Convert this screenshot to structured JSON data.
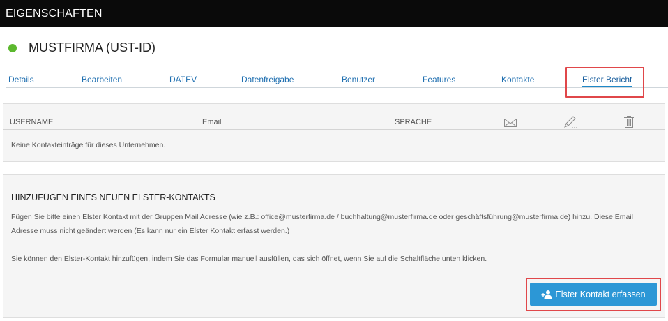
{
  "window": {
    "title": "EIGENSCHAFTEN"
  },
  "company": {
    "name": "MUSTFIRMA (UST-ID)",
    "status_color": "#5cb82e"
  },
  "tabs": [
    {
      "label": "Details"
    },
    {
      "label": "Bearbeiten"
    },
    {
      "label": "DATEV"
    },
    {
      "label": "Datenfreigabe"
    },
    {
      "label": "Benutzer"
    },
    {
      "label": "Features"
    },
    {
      "label": "Kontakte"
    },
    {
      "label": "Elster Bericht",
      "active": true
    }
  ],
  "contacts_table": {
    "columns": [
      "USERNAME",
      "Email",
      "SPRACHE"
    ],
    "action_icons": [
      "envelope-icon",
      "pencil-icon",
      "trash-icon"
    ],
    "empty_message": "Keine Kontakteinträge für dieses Unternehmen."
  },
  "elster_section": {
    "title": "HINZUFÜGEN EINES NEUEN ELSTER-KONTAKTS",
    "paragraph1": "Fügen Sie bitte einen Elster Kontakt mit der Gruppen Mail Adresse (wie z.B.: office@musterfirma.de / buchhaltung@musterfirma.de oder geschäftsführung@musterfirma.de) hinzu. Diese Email Adresse muss nicht geändert werden (Es kann nur ein Elster Kontakt erfasst werden.)",
    "paragraph2": "Sie können den Elster-Kontakt hinzufügen, indem Sie das Formular manuell ausfüllen, das sich öffnet, wenn Sie auf die Schaltfläche unten klicken.",
    "button_label": "Elster Kontakt erfassen"
  },
  "colors": {
    "accent": "#2c97d6",
    "highlight": "#e0474a",
    "link": "#1f6fb0"
  }
}
